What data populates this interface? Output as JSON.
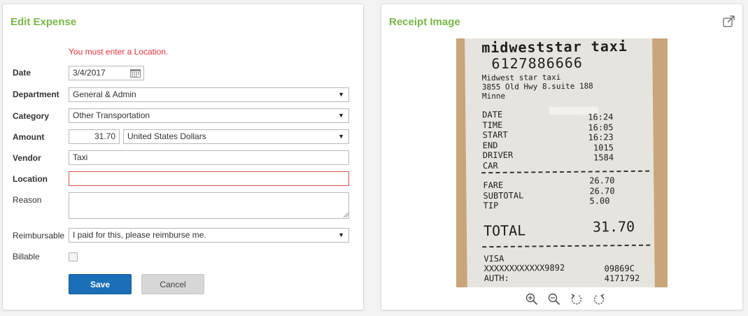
{
  "edit_panel": {
    "title": "Edit Expense",
    "error": "You must enter a Location.",
    "labels": {
      "date": "Date",
      "department": "Department",
      "category": "Category",
      "amount": "Amount",
      "vendor": "Vendor",
      "location": "Location",
      "reason": "Reason",
      "reimbursable": "Reimbursable",
      "billable": "Billable"
    },
    "values": {
      "date": "3/4/2017",
      "department": "General & Admin",
      "category": "Other Transportation",
      "amount": "31.70",
      "currency": "United States Dollars",
      "vendor": "Taxi",
      "location": "",
      "reason": "",
      "reimbursable": "I paid for this, please reimburse me.",
      "billable": false
    },
    "buttons": {
      "save": "Save",
      "cancel": "Cancel"
    }
  },
  "receipt_panel": {
    "title": "Receipt Image",
    "receipt": {
      "header": "midweststar taxi",
      "phone": "6127886666",
      "name": "Midwest star taxi",
      "address": "3855 Old Hwy 8.suite 188",
      "city": "Minne",
      "rows": [
        {
          "label": "DATE",
          "value": ""
        },
        {
          "label": "TIME",
          "value": "16:24"
        },
        {
          "label": "START",
          "value": "16:05"
        },
        {
          "label": "END",
          "value": "16:23"
        },
        {
          "label": "DRIVER",
          "value": "1015"
        },
        {
          "label": "CAR",
          "value": "1584"
        }
      ],
      "amounts": [
        {
          "label": "FARE",
          "value": "26.70"
        },
        {
          "label": "SUBTOTAL",
          "value": "26.70"
        },
        {
          "label": "TIP",
          "value": "5.00"
        }
      ],
      "total_label": "TOTAL",
      "total_value": "31.70",
      "card": "VISA",
      "card_number": "XXXXXXXXXXXX9892",
      "auth_label": "AUTH:",
      "auth_code": "09869C",
      "auth_extra": "4171792"
    },
    "tools": [
      "zoom-in-icon",
      "zoom-out-icon",
      "rotate-left-icon",
      "rotate-right-icon"
    ]
  },
  "colors": {
    "title_green": "#7ab648",
    "error_red": "#e0313a",
    "primary_blue": "#1a6fb8"
  }
}
